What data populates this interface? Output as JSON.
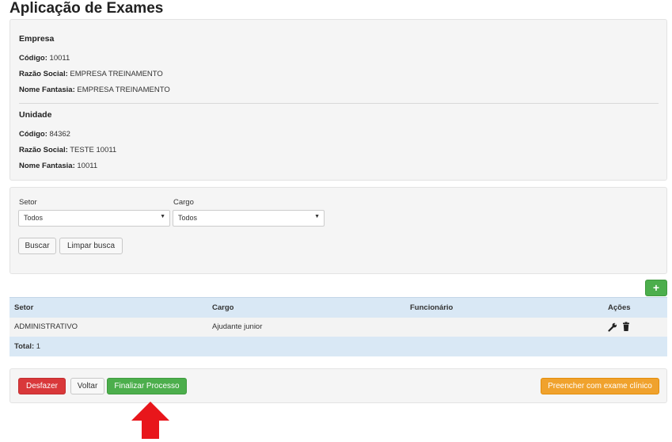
{
  "page": {
    "title": "Aplicação de Exames"
  },
  "empresa": {
    "title": "Empresa",
    "codigo_label": "Código:",
    "codigo": "10011",
    "razao_label": "Razão Social:",
    "razao": "EMPRESA TREINAMENTO",
    "fantasia_label": "Nome Fantasia:",
    "fantasia": "EMPRESA TREINAMENTO"
  },
  "unidade": {
    "title": "Unidade",
    "codigo_label": "Código:",
    "codigo": "84362",
    "razao_label": "Razão Social:",
    "razao": "TESTE 10011",
    "fantasia_label": "Nome Fantasia:",
    "fantasia": "10011"
  },
  "filters": {
    "setor_label": "Setor",
    "setor_value": "Todos",
    "cargo_label": "Cargo",
    "cargo_value": "Todos",
    "buscar": "Buscar",
    "limpar": "Limpar busca"
  },
  "table": {
    "add": "+",
    "headers": [
      "Setor",
      "Cargo",
      "Funcionário",
      "Ações"
    ],
    "rows": [
      {
        "setor": "ADMINISTRATIVO",
        "cargo": "Ajudante junior",
        "funcionario": ""
      }
    ],
    "total_label": "Total:",
    "total": "1"
  },
  "actions": {
    "desfazer": "Desfazer",
    "voltar": "Voltar",
    "finalizar": "Finalizar Processo",
    "preencher": "Preencher com exame clínico"
  },
  "icons": {
    "edit": "wrench-icon",
    "delete": "trash-icon",
    "pointer": "arrow-up-icon",
    "arrow_color": "#e8161b"
  }
}
